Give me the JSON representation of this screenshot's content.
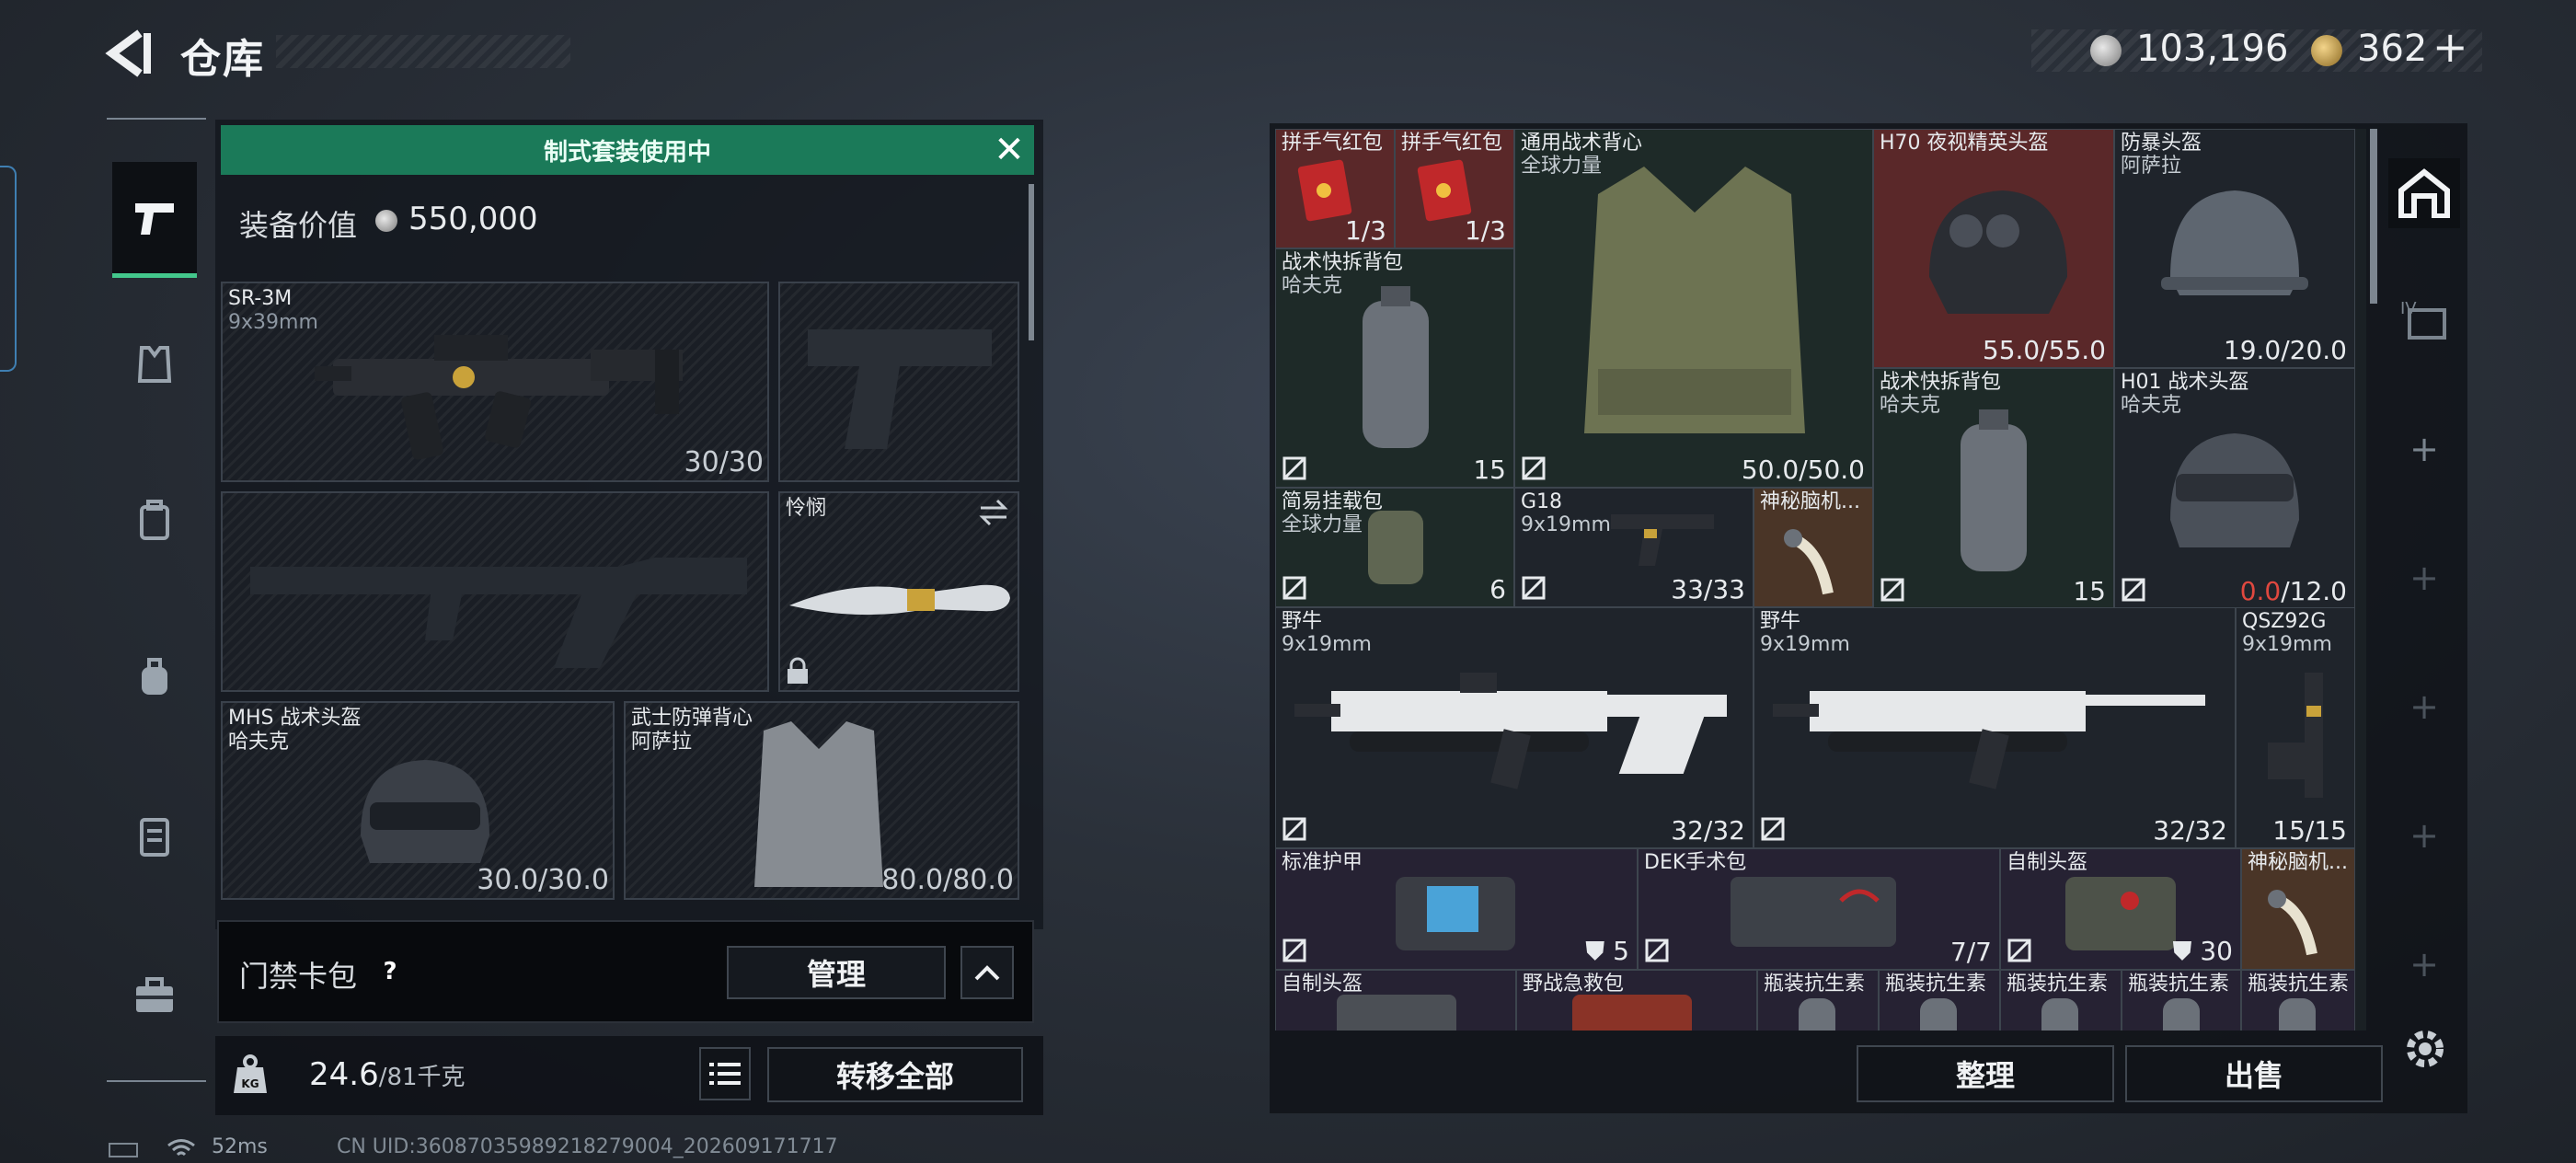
{
  "header": {
    "title": "仓库",
    "currency_silver": "103,196",
    "currency_gold": "362",
    "plus": "+"
  },
  "loadout": {
    "banner": "制式套装使用中",
    "value_label": "装备价值",
    "value": "550,000",
    "slots": {
      "primary": {
        "name": "SR-3M",
        "sub": "9x39mm",
        "count": "30/30"
      },
      "knife": {
        "name": "怜悯"
      },
      "helmet": {
        "name": "MHS 战术头盔",
        "sub": "哈夫克",
        "durability": "30.0/30.0"
      },
      "armor": {
        "name": "武士防弹背心",
        "sub": "阿萨拉",
        "durability": "80.0/80.0"
      }
    },
    "access_card": {
      "label": "门禁卡包",
      "help": "?",
      "manage": "管理"
    },
    "weight": "24.6",
    "weight_max": "/81千克",
    "transfer_all": "转移全部"
  },
  "status": {
    "ping": "52ms",
    "uid": "CN UID:36087035989218279004_202609171717"
  },
  "inventory": {
    "items": [
      {
        "name": "拼手气红包",
        "count": "1/3"
      },
      {
        "name": "拼手气红包",
        "count": "1/3"
      },
      {
        "name": "通用战术背心",
        "sub": "全球力量",
        "count": "50.0/50.0"
      },
      {
        "name": "H70 夜视精英头盔",
        "count": "55.0/55.0"
      },
      {
        "name": "防暴头盔",
        "sub": "阿萨拉",
        "count": "19.0/20.0"
      },
      {
        "name": "战术快拆背包",
        "sub": "哈夫克",
        "count": "15"
      },
      {
        "name": "战术快拆背包",
        "sub": "哈夫克",
        "count": "15"
      },
      {
        "name": "H01 战术头盔",
        "sub": "哈夫克",
        "count_low": "0.0",
        "count_rest": "/12.0"
      },
      {
        "name": "简易挂载包",
        "sub": "全球力量",
        "count": "6"
      },
      {
        "name": "G18",
        "sub": "9x19mm",
        "count": "33/33"
      },
      {
        "name": "神秘脑机..."
      },
      {
        "name": "野牛",
        "sub": "9x19mm",
        "count": "32/32"
      },
      {
        "name": "野牛",
        "sub": "9x19mm",
        "count": "32/32"
      },
      {
        "name": "QSZ92G",
        "sub": "9x19mm",
        "count": "15/15"
      },
      {
        "name": "标准护甲",
        "count": "5"
      },
      {
        "name": "DEK手术包",
        "count": "7/7"
      },
      {
        "name": "自制头盔",
        "count": "30"
      },
      {
        "name": "神秘脑机..."
      },
      {
        "name": "自制头盔"
      },
      {
        "name": "野战急救包"
      },
      {
        "name": "瓶装抗生素"
      },
      {
        "name": "瓶装抗生素"
      },
      {
        "name": "瓶装抗生素"
      },
      {
        "name": "瓶装抗生素"
      },
      {
        "name": "瓶装抗生素"
      }
    ],
    "sort": "整理",
    "sell": "出售"
  },
  "colors": {
    "accent_green": "#1b7a59",
    "rarity_red": "#5a2829",
    "rarity_gold": "#4a3527",
    "rarity_green": "#1e2a28",
    "low_durability": "#e0483f"
  },
  "icons": [
    "back-arrow-icon",
    "silver-coin-icon",
    "gold-coin-icon",
    "pistol-icon",
    "armor-icon",
    "backpack-icon",
    "chest-rig-icon",
    "case-icon",
    "toolbox-icon",
    "close-icon",
    "swap-icon",
    "lock-icon",
    "question-icon",
    "chevron-up-icon",
    "weight-icon",
    "list-icon",
    "unlock-icon",
    "case-slot-icon",
    "plus-icon",
    "gear-icon"
  ]
}
